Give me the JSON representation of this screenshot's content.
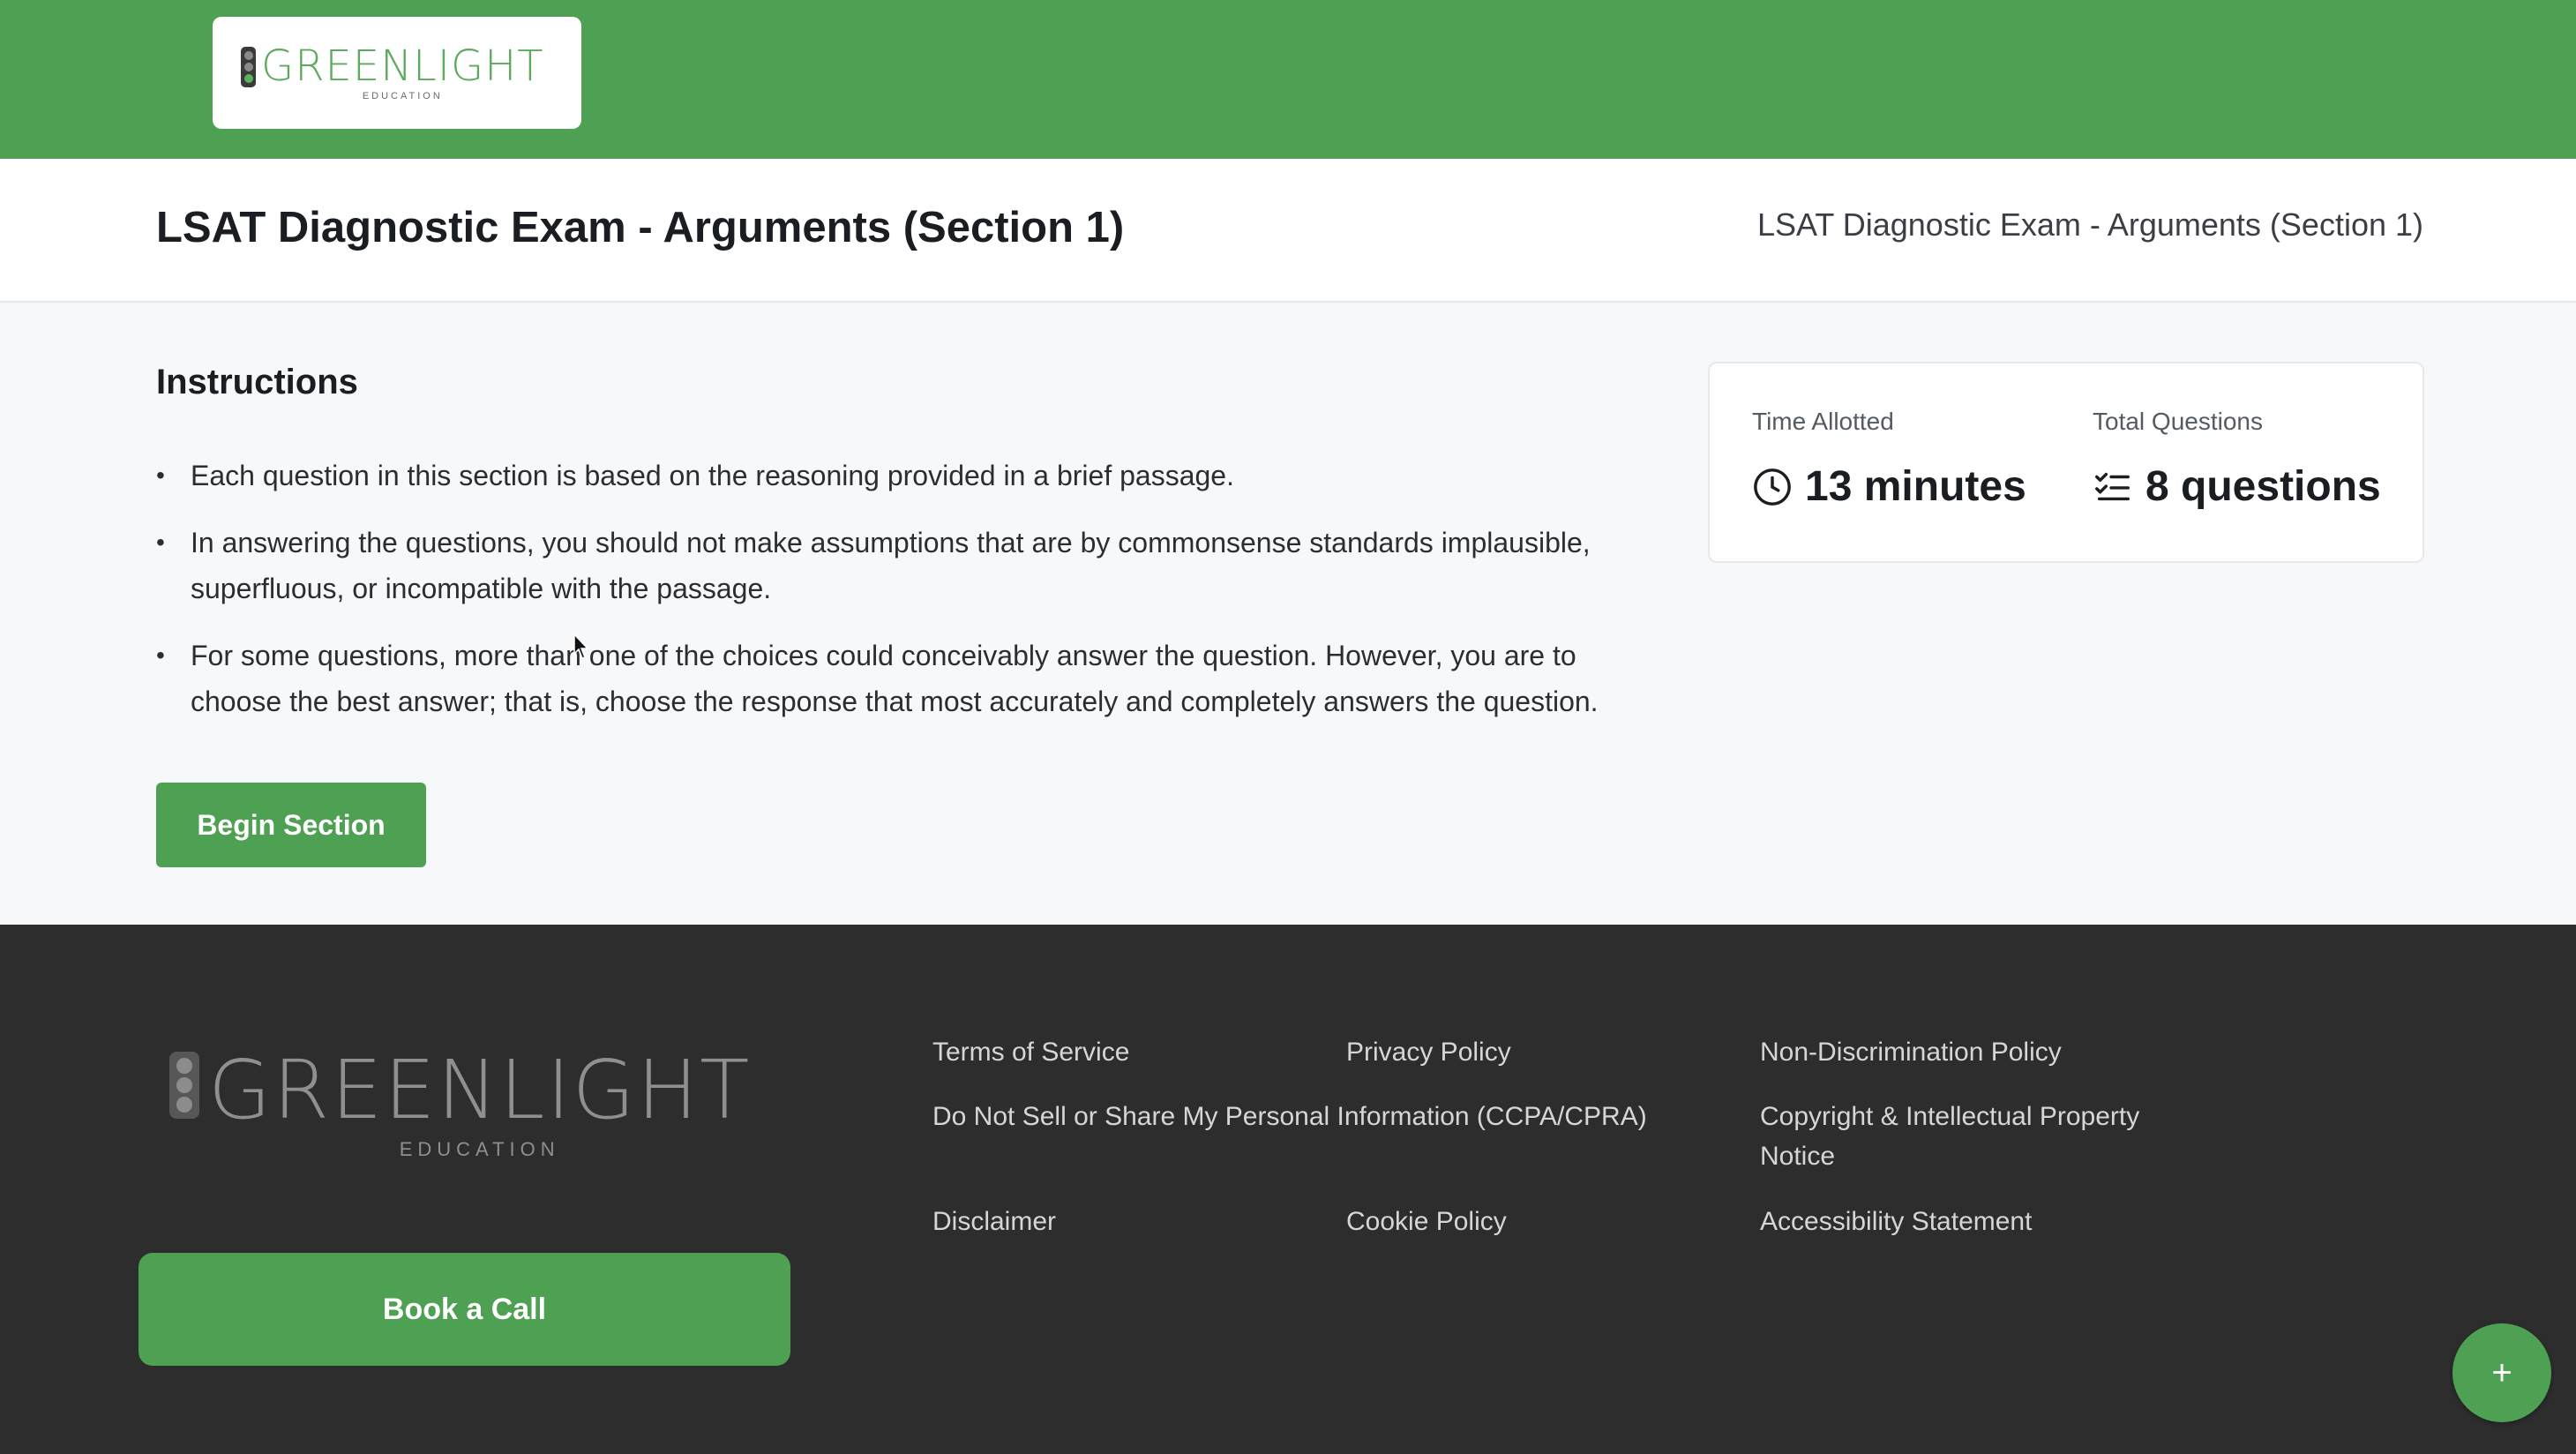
{
  "brand": {
    "name": "GREENLIGHT",
    "name_green": "GREEN",
    "name_light": "LIGHT",
    "subtitle": "EDUCATION",
    "color": "#4ea153"
  },
  "header": {
    "title": "LSAT Diagnostic Exam - Arguments (Section 1)",
    "crumb": "LSAT Diagnostic Exam - Arguments (Section 1)"
  },
  "instructions": {
    "heading": "Instructions",
    "items": [
      "Each question in this section is based on the reasoning provided in a brief passage.",
      "In answering the questions, you should not make assumptions that are by commonsense standards implausible, superfluous, or incompatible with the passage.",
      "For some questions, more than one of the choices could conceivably answer the question. However, you are to choose the best answer; that is, choose the response that most accurately and completely answers the question."
    ],
    "bullet": "•",
    "begin_label": "Begin Section"
  },
  "stats": {
    "time_label": "Time Allotted",
    "time_value": "13 minutes",
    "time_icon": "clock-icon",
    "questions_label": "Total Questions",
    "questions_value": "8 questions",
    "questions_icon": "checklist-icon"
  },
  "footer": {
    "book_label": "Book a Call",
    "links": {
      "terms": "Terms of Service",
      "privacy": "Privacy Policy",
      "nondiscrimination": "Non-Discrimination Policy",
      "do_not_sell": "Do Not Sell or Share My Personal Information (CCPA/CPRA)",
      "copyright_line1": "Copyright & Intellectual Property",
      "copyright_line2": "Notice",
      "disclaimer": "Disclaimer",
      "cookie": "Cookie Policy",
      "accessibility": "Accessibility Statement"
    }
  },
  "fab": {
    "label": "+",
    "icon": "plus-icon"
  }
}
